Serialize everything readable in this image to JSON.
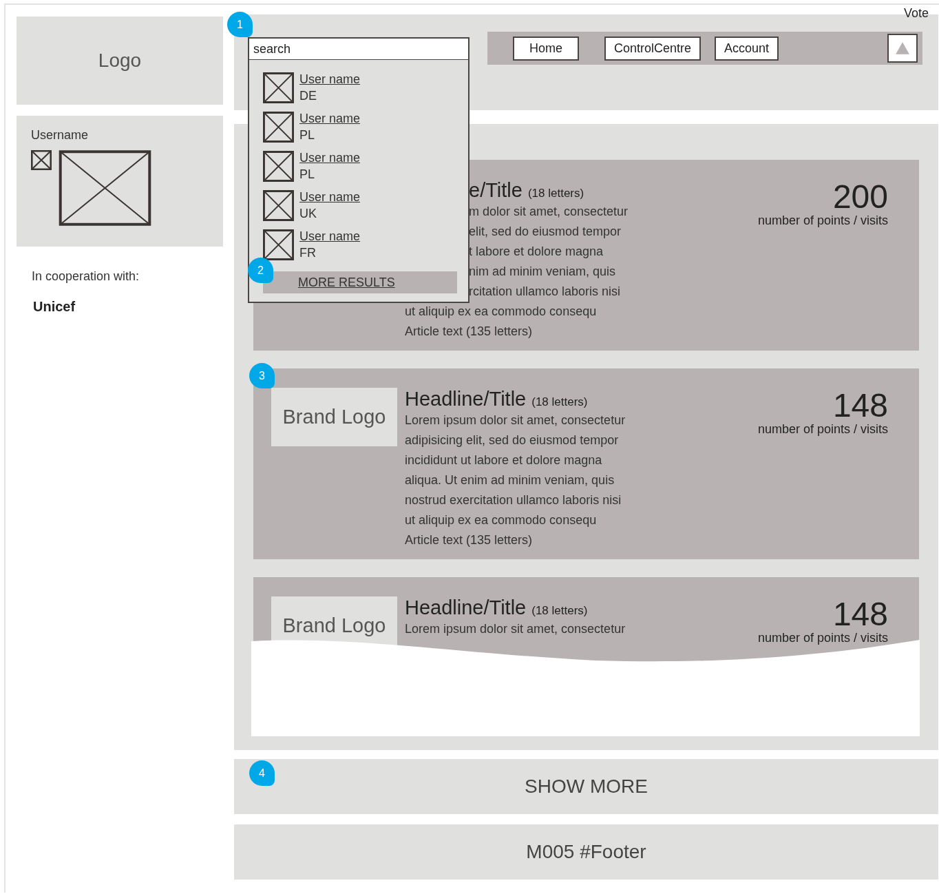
{
  "sidebar": {
    "logo": "Logo",
    "user": {
      "label": "Username"
    },
    "cooperation_label": "In cooperation with:",
    "partner": "Unicef"
  },
  "header": {
    "vote": "Vote",
    "search": {
      "placeholder": "search",
      "annotation": "1"
    },
    "nav": [
      {
        "label": "Home"
      },
      {
        "label": "ControlCentre"
      },
      {
        "label": "Account"
      }
    ]
  },
  "search_results": {
    "annotation": "2",
    "items": [
      {
        "name": "User name",
        "country": "DE"
      },
      {
        "name": "User name",
        "country": "PL"
      },
      {
        "name": "User name",
        "country": "PL"
      },
      {
        "name": "User name",
        "country": "UK"
      },
      {
        "name": "User name",
        "country": "FR"
      }
    ],
    "more": "MORE RESULTS"
  },
  "articles": [
    {
      "title": {
        "text": "e/Title",
        "kind": "partial"
      },
      "title_note": "(18 letters)",
      "points": "200",
      "points_label": "number of points / visits",
      "lines": [
        {
          "text": "m dolor sit amet, consectetur",
          "kind": "partial"
        },
        {
          "text": "elit, sed do eiusmod tempor",
          "kind": "partial"
        },
        {
          "text": "t labore et dolore magna",
          "kind": "partial"
        },
        {
          "text": "nim ad minim veniam, quis",
          "kind": "partial"
        },
        {
          "text": "rcitation ullamco laboris nisi",
          "kind": "partial"
        },
        {
          "text": "ut aliquip ex ea commodo consequ",
          "kind": "full"
        },
        {
          "text": "Article text (135 letters)",
          "kind": "full"
        }
      ]
    },
    {
      "annotation": "3",
      "brand": "Brand Logo",
      "title": {
        "text": "Headline/Title",
        "kind": "full"
      },
      "title_note": "(18 letters)",
      "points": "148",
      "points_label": "number of points / visits",
      "lines": [
        {
          "text": "Lorem ipsum dolor sit amet, consectetur",
          "kind": "full"
        },
        {
          "text": "adipisicing elit, sed do eiusmod tempor",
          "kind": "full"
        },
        {
          "text": "incididunt ut labore et dolore magna",
          "kind": "full"
        },
        {
          "text": "aliqua. Ut enim ad minim veniam, quis",
          "kind": "full"
        },
        {
          "text": "nostrud exercitation ullamco laboris nisi",
          "kind": "full"
        },
        {
          "text": "ut aliquip ex ea commodo consequ",
          "kind": "full"
        },
        {
          "text": "Article text (135 letters)",
          "kind": "full"
        }
      ]
    },
    {
      "brand": "Brand Logo",
      "title": {
        "text": "Headline/Title",
        "kind": "full"
      },
      "title_note": "(18 letters)",
      "points": "148",
      "points_label": "number of points / visits",
      "lines": [
        {
          "text": "Lorem ipsum dolor sit amet, consectetur",
          "kind": "full"
        }
      ]
    }
  ],
  "show_more": {
    "label": "SHOW MORE",
    "annotation": "4"
  },
  "footer": {
    "label": "M005 #Footer"
  }
}
